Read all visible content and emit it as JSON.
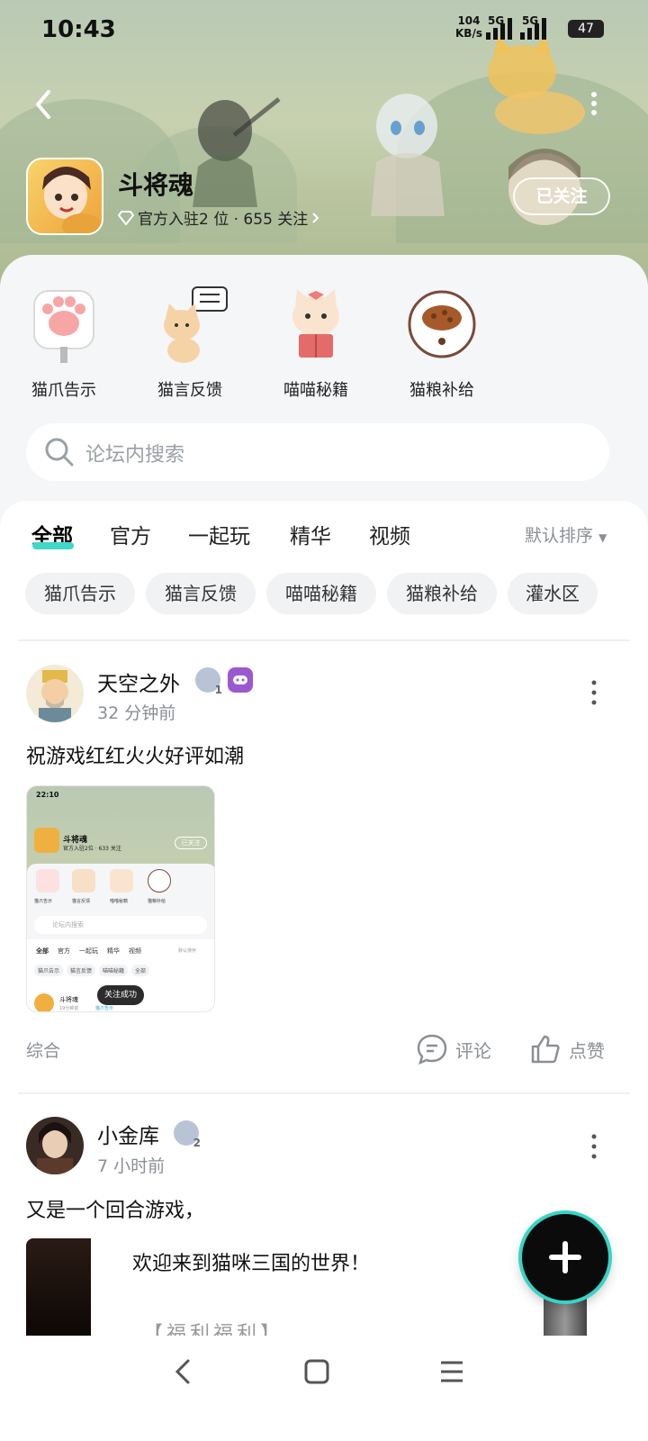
{
  "status_bar": {
    "time": "10:43",
    "net_speed_value": "104",
    "net_speed_unit": "KB/s",
    "sim1": "5G",
    "sim2": "5G",
    "battery": "47"
  },
  "header": {
    "forum_name": "斗将魂",
    "subtitle": "官方入驻2 位 · 655 关注",
    "follow_button": "已关注"
  },
  "quick_links": [
    {
      "label": "猫爪告示",
      "icon": "paw-sign-icon"
    },
    {
      "label": "猫言反馈",
      "icon": "cat-feedback-icon"
    },
    {
      "label": "喵喵秘籍",
      "icon": "cat-book-icon"
    },
    {
      "label": "猫粮补给",
      "icon": "cat-food-bowl-icon"
    }
  ],
  "search": {
    "placeholder": "论坛内搜索"
  },
  "tabs": [
    {
      "label": "全部",
      "active": true
    },
    {
      "label": "官方",
      "active": false
    },
    {
      "label": "一起玩",
      "active": false
    },
    {
      "label": "精华",
      "active": false
    },
    {
      "label": "视频",
      "active": false
    }
  ],
  "sort_label": "默认排序",
  "chips": [
    "猫爪告示",
    "猫言反馈",
    "喵喵秘籍",
    "猫粮补给",
    "灌水区"
  ],
  "posts": [
    {
      "author": "天空之外",
      "time": "32 分钟前",
      "text": "祝游戏红红火火好评如潮",
      "level": "1",
      "category": "综合",
      "comment_label": "评论",
      "like_label": "点赞",
      "image": {
        "time": "22:10",
        "forum_name": "斗将魂",
        "subtitle": "官方入驻2位 · 633 关注",
        "follow_button": "已关注",
        "quick_links": [
          "猫爪告示",
          "猫言反馈",
          "喵喵秘籍",
          "猫粮补给"
        ],
        "search_placeholder": "论坛内搜索",
        "tabs": [
          "全部",
          "官方",
          "一起玩",
          "精华",
          "视频"
        ],
        "sort_label": "默认排序",
        "chips": [
          "猫爪告示",
          "猫言反馈",
          "喵喵秘籍",
          "全部"
        ],
        "post_author": "斗将魂",
        "post_time": "19分钟前",
        "post_tag": "猫爪告示",
        "toast": "关注成功"
      }
    },
    {
      "author": "小金库",
      "time": "7 小时前",
      "text": "又是一个回合游戏，",
      "level": "2",
      "image_caption": "欢迎来到猫咪三国的世界！",
      "image_caption_2": "【福利福利】"
    }
  ],
  "colors": {
    "accent": "#3fd8c9",
    "muted": "#8a8f95",
    "banner": "#b9c9b4"
  }
}
